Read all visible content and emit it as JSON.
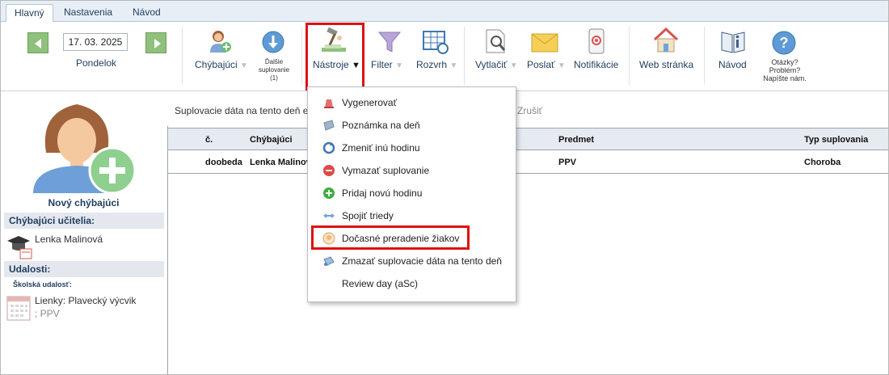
{
  "tabs": [
    {
      "label": "Hlavný",
      "active": true
    },
    {
      "label": "Nastavenia",
      "active": false
    },
    {
      "label": "Návod",
      "active": false
    }
  ],
  "toolbar": {
    "date": "17. 03. 2025",
    "weekday": "Pondelok",
    "chybajuci": "Chýbajúci",
    "dalsie_line1": "Ďalšie",
    "dalsie_line2": "suplovanie",
    "dalsie_line3": "(1)",
    "nastroje": "Nástroje",
    "filter": "Filter",
    "rozvrh": "Rozvrh",
    "vytlacit": "Vytlačiť",
    "poslat": "Poslať",
    "notifikacie": "Notifikácie",
    "web": "Web stránka",
    "navod": "Návod",
    "otazky_line1": "Otázky?",
    "otazky_line2": "Problém?",
    "otazky_line3": "Napíšte nám.",
    "caret": "▼"
  },
  "left_panel": {
    "new_absent": "Nový chýbajúci",
    "absent_teachers_header": "Chýbajúci učitelia:",
    "absent_teacher": "Lenka Malinová",
    "events_header": "Udalosti:",
    "school_event_label": "Školská udalosť:",
    "event_line1": "Lienky: Plavecký výcvik",
    "event_line2": "; PPV"
  },
  "main": {
    "info_text": "Suplovacie dáta na tento deň e",
    "cancel_text": "Zrušiť",
    "columns": [
      "č.",
      "Chýbajúci",
      "Predmet",
      "Typ suplovania"
    ],
    "rows": [
      {
        "c": "doobeda",
        "chybajuci": "Lenka Malinov",
        "predmet": "PPV",
        "typ": "Choroba"
      }
    ]
  },
  "menu": {
    "items": [
      {
        "label": "Vygenerovať",
        "icon": "generate-icon"
      },
      {
        "label": "Poznámka na deň",
        "icon": "note-icon"
      },
      {
        "label": "Zmeniť inú hodinu",
        "icon": "refresh-icon"
      },
      {
        "label": "Vymazať suplovanie",
        "icon": "delete-icon"
      },
      {
        "label": "Pridaj novú hodinu",
        "icon": "add-icon"
      },
      {
        "label": "Spojiť triedy",
        "icon": "merge-arrows-icon"
      },
      {
        "label": "Dočasné preradenie žiakov",
        "icon": "reassign-students-icon"
      },
      {
        "label": "Zmazať suplovacie dáta na tento deň",
        "icon": "erase-icon"
      },
      {
        "label": "Review day (aSc)",
        "icon": ""
      }
    ]
  },
  "colors": {
    "highlight": "#e01010",
    "header_blue": "#1f3d5f",
    "nav_green": "#8fc07c"
  }
}
